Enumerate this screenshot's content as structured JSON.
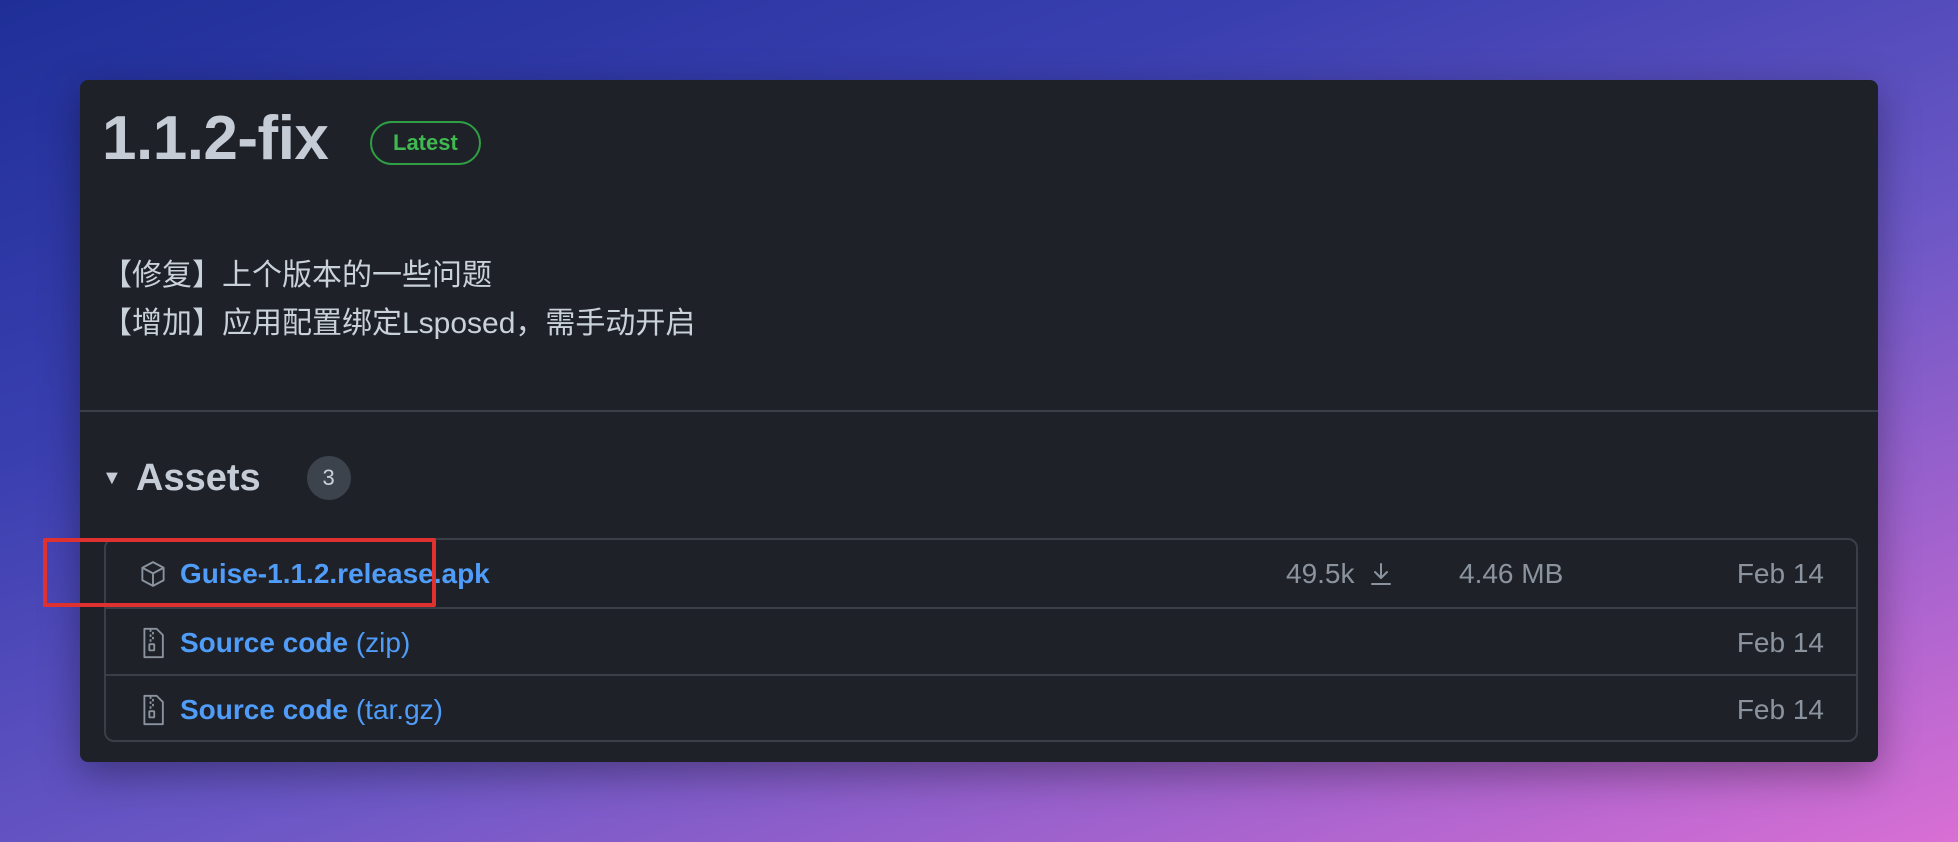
{
  "release": {
    "title": "1.1.2-fix",
    "badge": "Latest",
    "notes": [
      "【修复】上个版本的一些问题",
      "【增加】应用配置绑定Lsposed，需手动开启"
    ]
  },
  "assets": {
    "caret": "▼",
    "title": "Assets",
    "count": "3",
    "rows": [
      {
        "icon": "package-icon",
        "name": "Guise-1.1.2.release.apk",
        "suffix": "",
        "downloads": "49.5k",
        "size": "4.46 MB",
        "date": "Feb 14"
      },
      {
        "icon": "file-zip-icon",
        "name": "Source code",
        "suffix": "(zip)",
        "downloads": "",
        "size": "",
        "date": "Feb 14"
      },
      {
        "icon": "file-zip-icon",
        "name": "Source code",
        "suffix": "(tar.gz)",
        "downloads": "",
        "size": "",
        "date": "Feb 14"
      }
    ]
  },
  "colors": {
    "link": "#4f9cf9",
    "badge_green": "#3fb950",
    "highlight": "#e03131",
    "card_bg": "#1f2128"
  }
}
